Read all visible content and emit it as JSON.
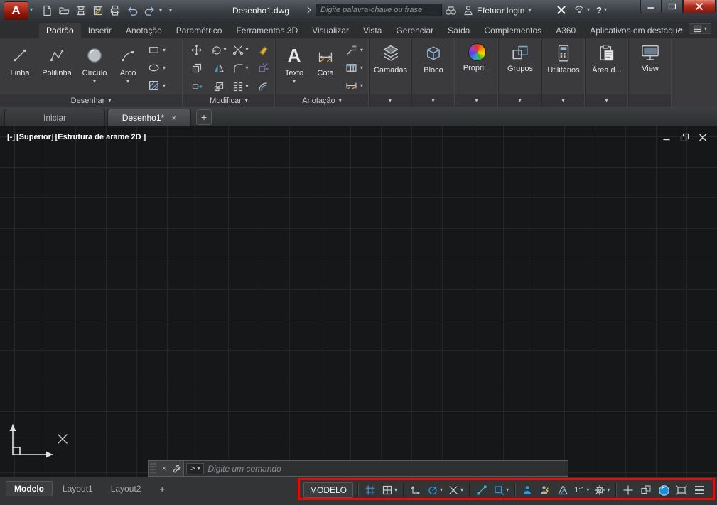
{
  "titlebar": {
    "title": "Desenho1.dwg",
    "search_placeholder": "Digite palavra-chave ou frase",
    "login_label": "Efetuar login"
  },
  "ribbon": {
    "tabs": [
      "Padrão",
      "Inserir",
      "Anotação",
      "Paramétrico",
      "Ferramentas 3D",
      "Visualizar",
      "Vista",
      "Gerenciar",
      "Saída",
      "Complementos",
      "A360",
      "Aplicativos em destaque"
    ],
    "panels": {
      "desenhar": {
        "title": "Desenhar",
        "linha": "Linha",
        "polilinha": "Polilinha",
        "circulo": "Círculo",
        "arco": "Arco"
      },
      "modificar": {
        "title": "Modificar"
      },
      "anotacao": {
        "title": "Anotação",
        "texto": "Texto",
        "cota": "Cota"
      },
      "camadas": "Camadas",
      "bloco": "Bloco",
      "propriedades": "Propri...",
      "grupos": "Grupos",
      "utilitarios": "Utilitários",
      "area": "Área d...",
      "view": "View"
    }
  },
  "file_tabs": {
    "iniciar": "Iniciar",
    "desenho1": "Desenho1*"
  },
  "viewport": {
    "segments": [
      "[-]",
      "[Superior]",
      "[Estrutura de arame 2D ]"
    ]
  },
  "command_line": {
    "placeholder": "Digite um comando"
  },
  "layout_tabs": {
    "modelo": "Modelo",
    "layout1": "Layout1",
    "layout2": "Layout2"
  },
  "status_bar": {
    "model": "MODELO",
    "scale": "1:1"
  },
  "glyphs": {
    "chevron_down": "▾",
    "double_chevron": "»",
    "close": "×",
    "plus": "+",
    "question": "?",
    "logo_letter": "A",
    "text_tool_letter": "A",
    "prompt": ">"
  }
}
